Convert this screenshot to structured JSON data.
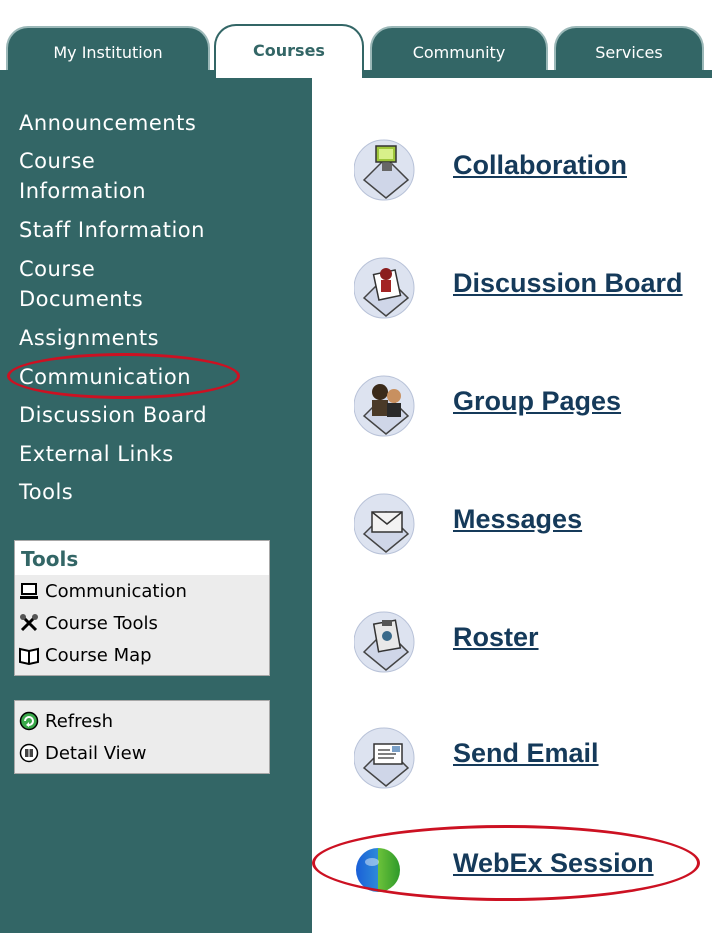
{
  "tabs": [
    {
      "label": "My Institution"
    },
    {
      "label": "Courses"
    },
    {
      "label": "Community"
    },
    {
      "label": "Services"
    }
  ],
  "sidebar": {
    "items": [
      {
        "label": "Announcements"
      },
      {
        "label": "Course"
      },
      {
        "label": "Information"
      },
      {
        "label": "Staff Information"
      },
      {
        "label": "Course"
      },
      {
        "label": "Documents"
      },
      {
        "label": "Assignments"
      },
      {
        "label": "Communication"
      },
      {
        "label": "Discussion Board"
      },
      {
        "label": "External Links"
      },
      {
        "label": "Tools"
      }
    ]
  },
  "tools_panel": {
    "title": "Tools",
    "rows": [
      {
        "label": "Communication",
        "icon": "computer-icon"
      },
      {
        "label": "Course Tools",
        "icon": "tools-icon"
      },
      {
        "label": "Course Map",
        "icon": "map-book-icon"
      }
    ]
  },
  "view_panel": {
    "rows": [
      {
        "label": "Refresh",
        "icon": "refresh-icon"
      },
      {
        "label": "Detail View",
        "icon": "detail-view-icon"
      }
    ]
  },
  "communication": {
    "items": [
      {
        "label": "Collaboration",
        "icon": "collaboration-icon"
      },
      {
        "label": "Discussion Board",
        "icon": "discussion-board-icon"
      },
      {
        "label": "Group Pages",
        "icon": "group-pages-icon"
      },
      {
        "label": "Messages",
        "icon": "messages-icon"
      },
      {
        "label": "Roster",
        "icon": "roster-icon"
      },
      {
        "label": "Send Email",
        "icon": "send-email-icon"
      },
      {
        "label": "WebEx Session",
        "icon": "webex-globe-icon"
      }
    ]
  },
  "colors": {
    "theme": "#336666",
    "link": "#153a5a",
    "highlight": "#cc1122"
  }
}
